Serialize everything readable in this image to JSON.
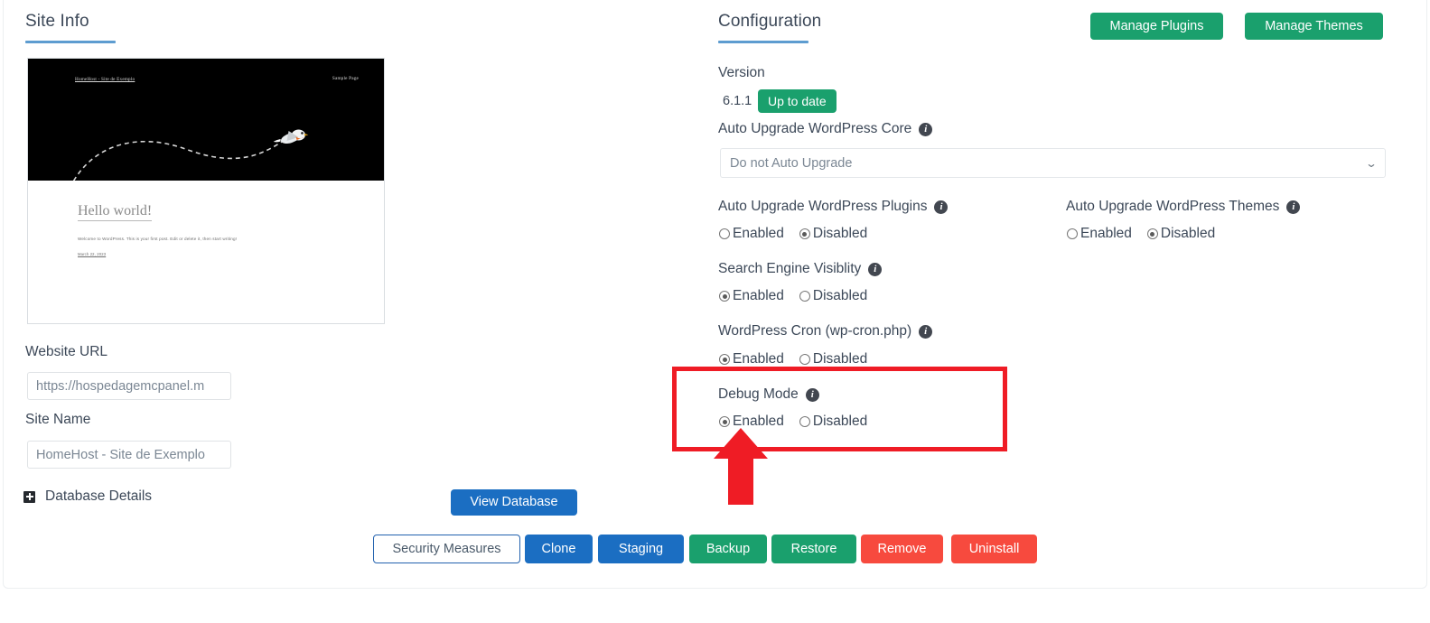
{
  "left_panel": {
    "heading": "Site Info",
    "preview": {
      "nav_left": "HomeHost - Site de Exemplo",
      "nav_right": "Sample Page",
      "post_title": "Hello world!",
      "post_excerpt": "Welcome to WordPress. This is your first post. Edit or delete it, then start writing!",
      "post_date": "March 22, 2023"
    },
    "website_url_label": "Website URL",
    "website_url_value": "https://hospedagemcpanel.m",
    "site_name_label": "Site Name",
    "site_name_value": "HomeHost - Site de Exemplo",
    "database_details_label": "Database Details",
    "database_details_icon": "plus-square-icon",
    "view_database_label": "View Database"
  },
  "right_panel": {
    "heading": "Configuration",
    "manage_plugins_label": "Manage Plugins",
    "manage_themes_label": "Manage Themes",
    "version_label": "Version",
    "version_number": "6.1.1",
    "version_badge": "Up to date",
    "auto_upgrade_core": {
      "label": "Auto Upgrade WordPress Core",
      "info_icon": "info-icon",
      "selected": "Do not Auto Upgrade",
      "caret_icon": "chevron-down-icon"
    },
    "auto_upgrade_plugins": {
      "label": "Auto Upgrade WordPress Plugins",
      "info_icon": "info-icon",
      "enabled_label": "Enabled",
      "disabled_label": "Disabled",
      "selected": "Disabled"
    },
    "auto_upgrade_themes": {
      "label": "Auto Upgrade WordPress Themes",
      "info_icon": "info-icon",
      "enabled_label": "Enabled",
      "disabled_label": "Disabled",
      "selected": "Disabled"
    },
    "search_engine_visibility": {
      "label": "Search Engine Visiblity",
      "info_icon": "info-icon",
      "enabled_label": "Enabled",
      "disabled_label": "Disabled",
      "selected": "Enabled"
    },
    "wordpress_cron": {
      "label": "WordPress Cron (wp-cron.php)",
      "info_icon": "info-icon",
      "enabled_label": "Enabled",
      "disabled_label": "Disabled",
      "selected": "Enabled"
    },
    "debug_mode": {
      "label": "Debug Mode",
      "info_icon": "info-icon",
      "enabled_label": "Enabled",
      "disabled_label": "Disabled",
      "selected": "Enabled"
    }
  },
  "action_bar": {
    "buttons": [
      {
        "label": "Security Measures",
        "style": "outline"
      },
      {
        "label": "Clone",
        "style": "blue"
      },
      {
        "label": "Staging",
        "style": "blue"
      },
      {
        "label": "Backup",
        "style": "green"
      },
      {
        "label": "Restore",
        "style": "green"
      },
      {
        "label": "Remove",
        "style": "red"
      },
      {
        "label": "Uninstall",
        "style": "red"
      }
    ]
  },
  "annotation": {
    "highlight_color": "#ef1c25",
    "target": "Debug Mode"
  },
  "colors": {
    "green": "#1aa06d",
    "blue": "#1b6ec2",
    "red": "#f74a3e",
    "accent_underline": "#5d9cd0",
    "annotation_red": "#ef1c25"
  }
}
